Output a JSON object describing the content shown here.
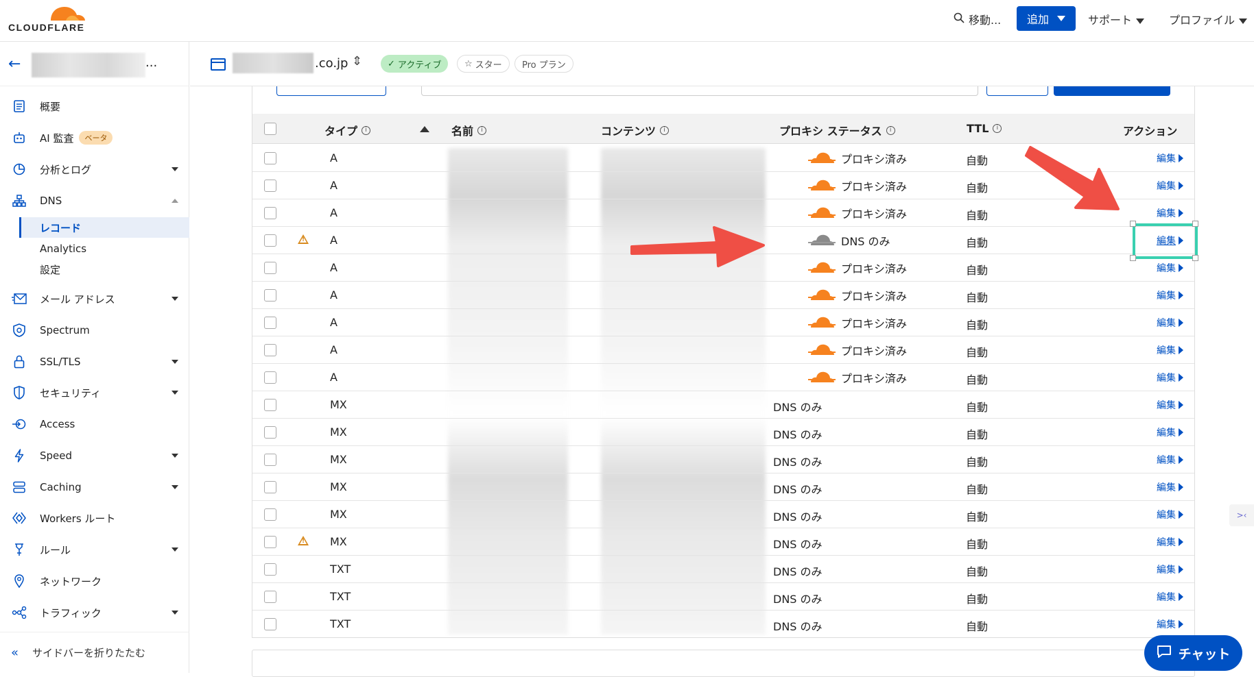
{
  "topbar": {
    "logo_text": "CLOUDFLARE",
    "search_label": "移動...",
    "add_label": "追加",
    "support_label": "サポート",
    "profile_label": "プロファイル"
  },
  "sidebar": {
    "account_suffix": "...",
    "items": [
      {
        "label": "概要",
        "icon": "document-icon"
      },
      {
        "label": "AI 監査",
        "icon": "robot-icon",
        "badge": "ベータ"
      },
      {
        "label": "分析とログ",
        "icon": "chart-icon"
      },
      {
        "label": "DNS",
        "icon": "network-icon"
      },
      {
        "label": "メール アドレス",
        "icon": "mail-icon"
      },
      {
        "label": "Spectrum",
        "icon": "shield-icon"
      },
      {
        "label": "SSL/TLS",
        "icon": "lock-icon"
      },
      {
        "label": "セキュリティ",
        "icon": "shield-icon"
      },
      {
        "label": "Access",
        "icon": "access-icon"
      },
      {
        "label": "Speed",
        "icon": "bolt-icon"
      },
      {
        "label": "Caching",
        "icon": "storage-icon"
      },
      {
        "label": "Workers ルート",
        "icon": "workers-icon"
      },
      {
        "label": "ルール",
        "icon": "rules-icon"
      },
      {
        "label": "ネットワーク",
        "icon": "pin-icon"
      },
      {
        "label": "トラフィック",
        "icon": "traffic-icon"
      }
    ],
    "dns_sub": [
      "レコード",
      "Analytics",
      "設定"
    ],
    "collapse_label": "サイドバーを折りたたむ"
  },
  "zone": {
    "name_suffix": ".co.jp",
    "status": "アクティブ",
    "star": "スター",
    "plan": "Pro プラン"
  },
  "table": {
    "headers": {
      "type": "タイプ",
      "name": "名前",
      "content": "コンテンツ",
      "proxy": "プロキシ ステータス",
      "ttl": "TTL",
      "action": "アクション"
    },
    "rows": [
      {
        "type": "A",
        "proxy": "プロキシ済み",
        "proxied": true,
        "ttl": "自動",
        "edit": "編集",
        "warn": false
      },
      {
        "type": "A",
        "proxy": "プロキシ済み",
        "proxied": true,
        "ttl": "自動",
        "edit": "編集",
        "warn": false
      },
      {
        "type": "A",
        "proxy": "プロキシ済み",
        "proxied": true,
        "ttl": "自動",
        "edit": "編集",
        "warn": false
      },
      {
        "type": "A",
        "proxy": "DNS のみ",
        "proxied": false,
        "cloud": true,
        "ttl": "自動",
        "edit": "編集",
        "warn": true
      },
      {
        "type": "A",
        "proxy": "プロキシ済み",
        "proxied": true,
        "ttl": "自動",
        "edit": "編集",
        "warn": false
      },
      {
        "type": "A",
        "proxy": "プロキシ済み",
        "proxied": true,
        "ttl": "自動",
        "edit": "編集",
        "warn": false
      },
      {
        "type": "A",
        "proxy": "プロキシ済み",
        "proxied": true,
        "ttl": "自動",
        "edit": "編集",
        "warn": false
      },
      {
        "type": "A",
        "proxy": "プロキシ済み",
        "proxied": true,
        "ttl": "自動",
        "edit": "編集",
        "warn": false
      },
      {
        "type": "A",
        "proxy": "プロキシ済み",
        "proxied": true,
        "ttl": "自動",
        "edit": "編集",
        "warn": false
      },
      {
        "type": "MX",
        "proxy": "DNS のみ",
        "proxied": false,
        "ttl": "自動",
        "edit": "編集",
        "warn": false
      },
      {
        "type": "MX",
        "proxy": "DNS のみ",
        "proxied": false,
        "ttl": "自動",
        "edit": "編集",
        "warn": false
      },
      {
        "type": "MX",
        "proxy": "DNS のみ",
        "proxied": false,
        "ttl": "自動",
        "edit": "編集",
        "warn": false
      },
      {
        "type": "MX",
        "proxy": "DNS のみ",
        "proxied": false,
        "ttl": "自動",
        "edit": "編集",
        "warn": false
      },
      {
        "type": "MX",
        "proxy": "DNS のみ",
        "proxied": false,
        "ttl": "自動",
        "edit": "編集",
        "warn": false
      },
      {
        "type": "MX",
        "proxy": "DNS のみ",
        "proxied": false,
        "ttl": "自動",
        "edit": "編集",
        "warn": true
      },
      {
        "type": "TXT",
        "proxy": "DNS のみ",
        "proxied": false,
        "ttl": "自動",
        "edit": "編集",
        "warn": false
      },
      {
        "type": "TXT",
        "proxy": "DNS のみ",
        "proxied": false,
        "ttl": "自動",
        "edit": "編集",
        "warn": false
      },
      {
        "type": "TXT",
        "proxy": "DNS のみ",
        "proxied": false,
        "ttl": "自動",
        "edit": "編集",
        "warn": false
      }
    ]
  },
  "chat_label": "チャット",
  "colors": {
    "accent": "#0051c3",
    "orange": "#f6821f",
    "highlight": "#3ad0b0",
    "arrow": "#ef4f45"
  }
}
